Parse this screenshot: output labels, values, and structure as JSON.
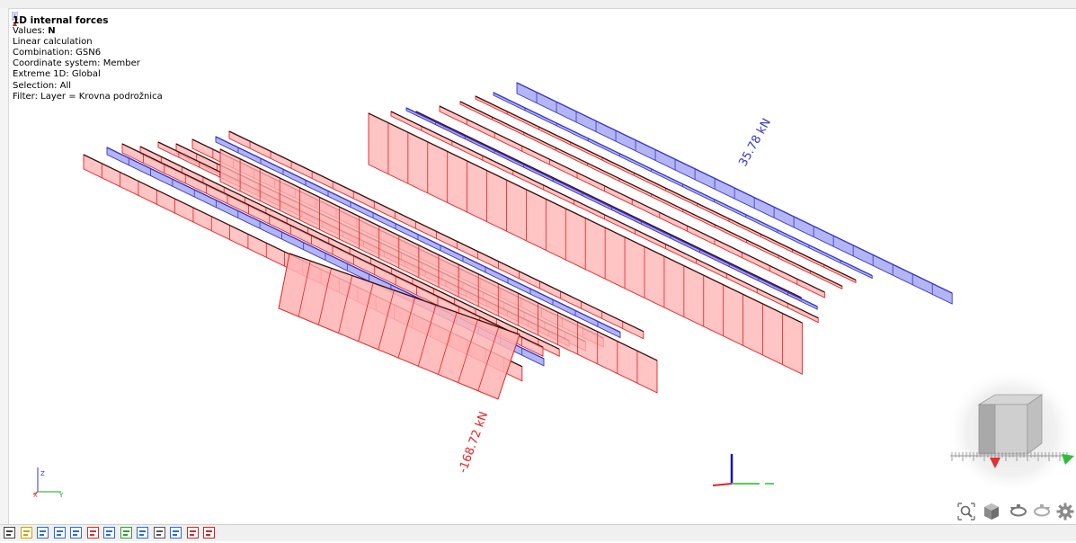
{
  "info": {
    "title": "1D internal forces",
    "values_prefix": "Values: ",
    "values": "N",
    "calc": "Linear calculation",
    "combination": "Combination: GSN6",
    "coord_system": "Coordinate system: Member",
    "extreme": "Extreme 1D: Global",
    "selection": "Selection: All",
    "filter": "Filter: Layer = Krovna podrožnica"
  },
  "labels": {
    "max": "35.78 kN",
    "min": "-168.72 kN"
  },
  "axes": {
    "x": "X",
    "y": "Y",
    "z": "Z"
  },
  "colors": {
    "compression_fill": "#ffb3b3",
    "compression_line": "#e52020",
    "tension_fill": "#9fa0f2",
    "tension_line": "#3535c8",
    "member_dark": "#3a1010"
  },
  "view_tools": [
    "zoom-all-icon",
    "view-cube-icon",
    "rotate-left-icon",
    "rotate-right-icon",
    "settings-gear-icon"
  ],
  "toolbar": [
    "view-3d-icon",
    "wireframe-icon",
    "structure-icon",
    "results-diagram-icon",
    "axis-icon",
    "loads-icon",
    "labels-icon",
    "numbers-icon",
    "mesh-icon",
    "sections-icon",
    "table-icon",
    "report-icon",
    "grid-icon"
  ]
}
